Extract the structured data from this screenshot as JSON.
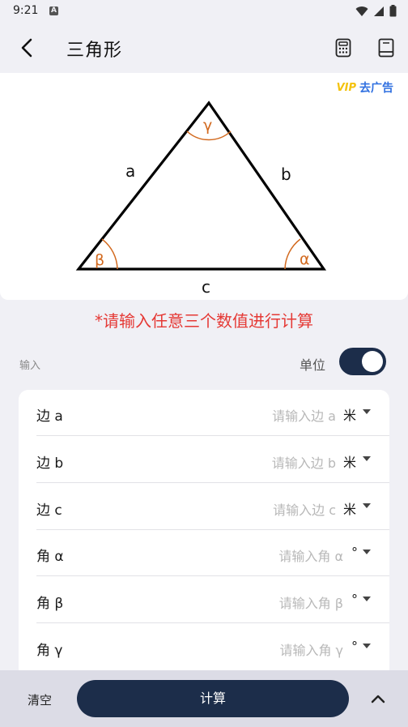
{
  "status": {
    "time": "9:21",
    "notification": "A"
  },
  "header": {
    "title": "三角形"
  },
  "diagram": {
    "vip_label": "VIP",
    "ad_label": "去广告",
    "side_a": "a",
    "side_b": "b",
    "side_c": "c",
    "angle_alpha": "α",
    "angle_beta": "β",
    "angle_gamma": "γ",
    "line_color": "#000000",
    "angle_color": "#d2691e"
  },
  "hint": "*请输入任意三个数值进行计算",
  "input_section": {
    "label": "输入",
    "unit_label": "单位",
    "unit_toggle_on": true
  },
  "fields": [
    {
      "label": "边 a",
      "placeholder": "请输入边 a",
      "unit": "米"
    },
    {
      "label": "边 b",
      "placeholder": "请输入边 b",
      "unit": "米"
    },
    {
      "label": "边 c",
      "placeholder": "请输入边 c",
      "unit": "米"
    },
    {
      "label": "角 α",
      "placeholder": "请输入角 α",
      "unit": "°"
    },
    {
      "label": "角 β",
      "placeholder": "请输入角 β",
      "unit": "°"
    },
    {
      "label": "角 γ",
      "placeholder": "请输入角 γ",
      "unit": "°"
    }
  ],
  "bottom": {
    "clear_label": "清空",
    "calc_label": "计算"
  },
  "colors": {
    "accent": "#1c2d4a",
    "hint": "#e53935",
    "ad": "#2f6fe0",
    "vip": "#f4c20d"
  }
}
